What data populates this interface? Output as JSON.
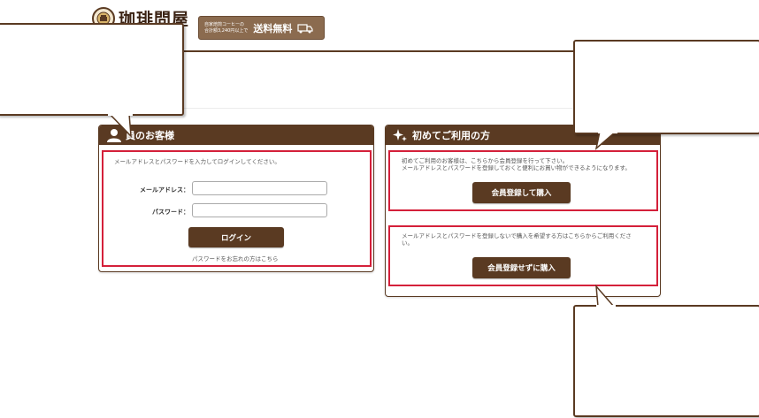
{
  "header": {
    "logo_text": "珈琲問屋",
    "promo_line1": "自家焙煎コーヒーの",
    "promo_line2": "合計額3,240円以上で",
    "promo_main": "送料無料"
  },
  "member_panel": {
    "title": "員のお客様",
    "description": "メールアドレスとパスワードを入力してログインしてください。",
    "email_label": "メールアドレス：",
    "email_value": "",
    "password_label": "パスワード：",
    "password_value": "",
    "login_button": "ログイン",
    "forgot_link": "パスワードをお忘れの方はこちら"
  },
  "first_panel": {
    "title": "初めてご利用の方",
    "desc1_line1": "初めてご利用のお客様は、こちらから会員登録を行って下さい。",
    "desc1_line2": "メールアドレスとパスワードを登録しておくと便利にお買い物ができるようになります。",
    "register_button": "会員登録して購入",
    "desc2_line1": "メールアドレスとパスワードを登録しないで購入を希望する方はこちらからご利用くださ",
    "desc2_line2": "い。",
    "guest_button": "会員登録せずに購入"
  },
  "colors": {
    "brand_brown": "#5a3a22",
    "highlight_red": "#d4203a",
    "promo_bg": "#8b6b4f"
  }
}
